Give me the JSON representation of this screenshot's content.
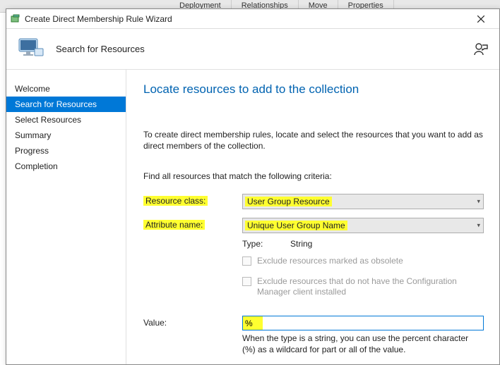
{
  "bg_toolbar": {
    "deployment": "Deployment",
    "relationships": "Relationships",
    "move": "Move",
    "properties": "Properties"
  },
  "dialog": {
    "title": "Create Direct Membership Rule Wizard",
    "header": {
      "title": "Search for Resources"
    },
    "nav": {
      "welcome": "Welcome",
      "search": "Search for Resources",
      "select": "Select Resources",
      "summary": "Summary",
      "progress": "Progress",
      "completion": "Completion"
    },
    "content": {
      "heading": "Locate resources to add to the collection",
      "blurb": "To create direct membership rules, locate and select the resources that you want to add as direct members of the collection.",
      "criteria": "Find all resources that match the following criteria:",
      "resource_class_label": "Resource class:",
      "resource_class_value": "User Group Resource",
      "attribute_name_label": "Attribute name:",
      "attribute_name_value": "Unique User Group Name",
      "type_label": "Type:",
      "type_value": "String",
      "exclude_obsolete": "Exclude resources marked as obsolete",
      "exclude_noclient": "Exclude resources that do not have the Configuration Manager client installed",
      "value_label": "Value:",
      "value_input": "%",
      "value_hint": "When the type is a string, you can use the percent character (%) as a wildcard for part or all of the value."
    }
  }
}
